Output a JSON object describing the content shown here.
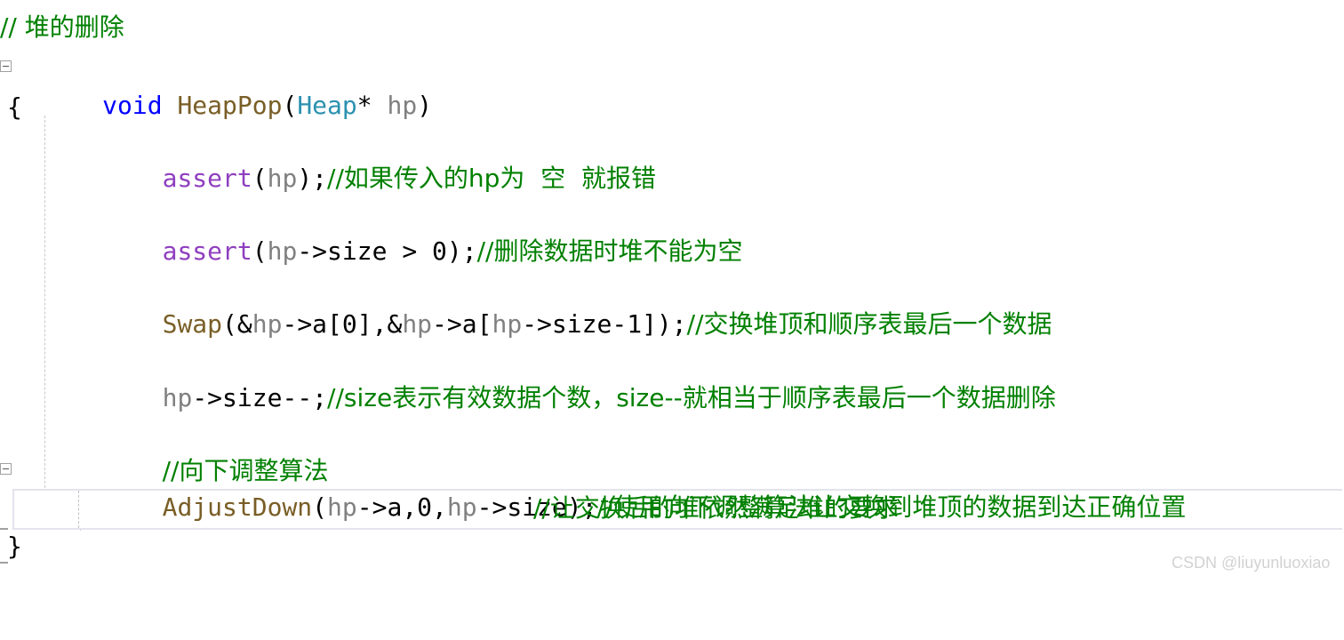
{
  "editor": {
    "language": "c",
    "background_color": "#ffffff",
    "current_line_highlight_color": "#e4e4ee",
    "colors": {
      "comment": "#008000",
      "keyword": "#0000ff",
      "function": "#795e26",
      "type": "#2b91af",
      "variable": "#808080",
      "macro": "#8f3fbf",
      "plain": "#000000",
      "indent_guide": "#c8c8c8",
      "watermark": "#d2d2d2"
    }
  },
  "code": {
    "line1_comment": "// 堆的删除",
    "line2_keyword_void": "void",
    "line2_space1": " ",
    "line2_funcname": "HeapPop",
    "line2_paren_open": "(",
    "line2_type": "Heap",
    "line2_star": "*",
    "line2_space2": " ",
    "line2_param": "hp",
    "line2_paren_close": ")",
    "line3_brace_open": "{",
    "line4_indent": "    ",
    "line4_macro": "assert",
    "line4_open": "(",
    "line4_var": "hp",
    "line4_close": ");",
    "line4_comment": "//如果传入的hp为  空  就报错",
    "line6_indent": "    ",
    "line6_macro": "assert",
    "line6_open": "(",
    "line6_var": "hp",
    "line6_expr": "->size > 0",
    "line6_close": ");",
    "line6_comment": "//删除数据时堆不能为空",
    "line8_indent": "    ",
    "line8_funcname": "Swap",
    "line8_p1": "(&",
    "line8_var1": "hp",
    "line8_p2": "->a[0],&",
    "line8_var2": "hp",
    "line8_p3": "->a[",
    "line8_var3": "hp",
    "line8_p4": "->size-1]);",
    "line8_comment": "//交换堆顶和顺序表最后一个数据",
    "line10_indent": "    ",
    "line10_var": "hp",
    "line10_expr": "->size--;",
    "line10_comment": "//size表示有效数据个数，size--就相当于顺序表最后一个数据删除",
    "line12_indent": "    ",
    "line12_comment": "//向下调整算法",
    "line13_indent": "    ",
    "line13_funcname": "AdjustDown",
    "line13_p1": "(",
    "line13_var1": "hp",
    "line13_p2": "->a,0,",
    "line13_var2": "hp",
    "line13_p3": "->size);",
    "line13_comment": "//使用向下调整算法让交换到堆顶的数据到达正确位置",
    "line14_comment": "//让交换后的堆依然满足堆的要求",
    "line15_brace_close": "}"
  },
  "watermark": {
    "text": "CSDN @liuyunluoxiao"
  }
}
